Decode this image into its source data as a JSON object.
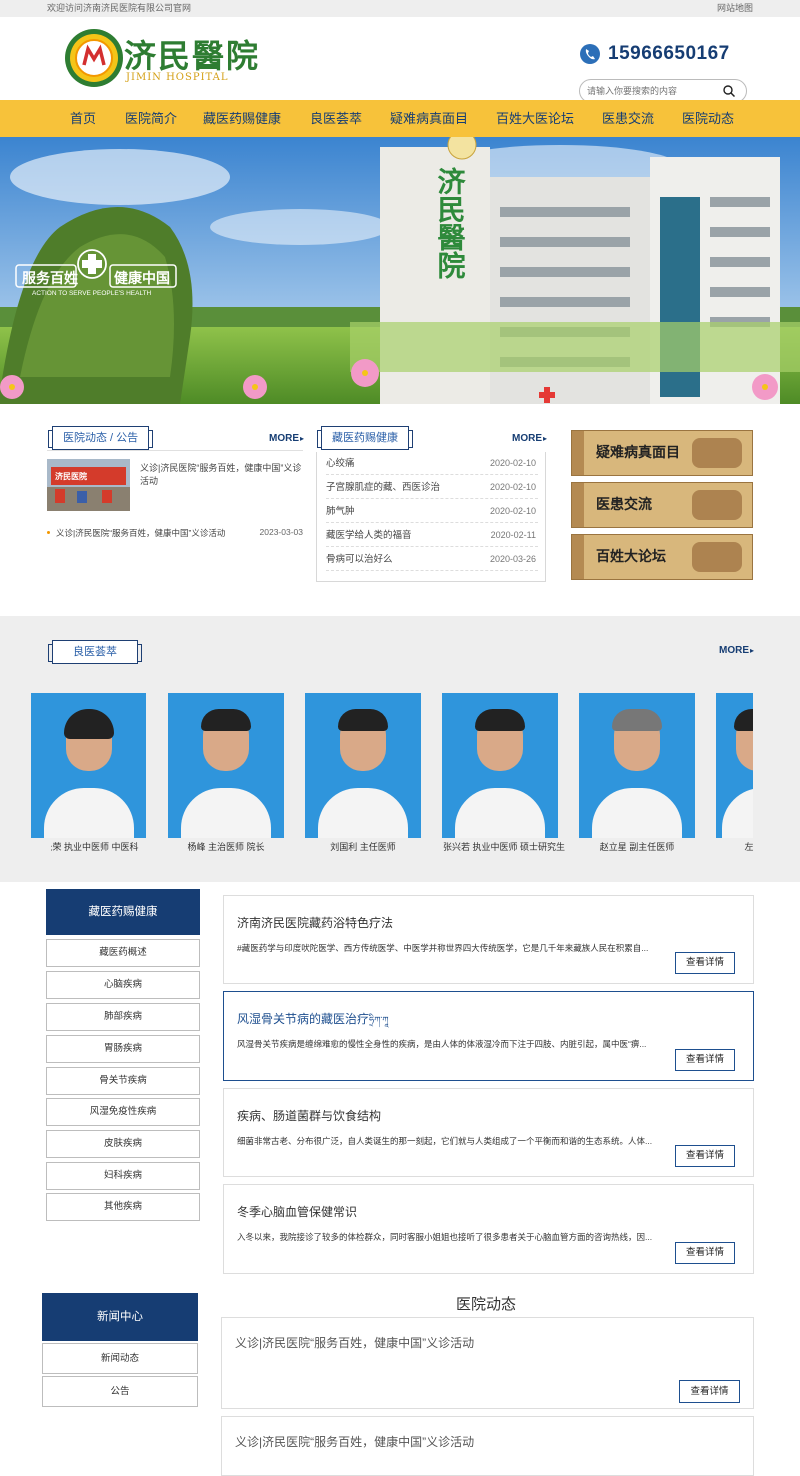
{
  "topbar": {
    "welcome": "欢迎访问济南济民医院有限公司官网",
    "sitemap": "网站地图"
  },
  "header": {
    "logo_cn": "济民醫院",
    "logo_en": "JIMIN HOSPITAL",
    "phone": "15966650167",
    "search_placeholder": "请输入你要搜索的内容"
  },
  "nav": [
    "首页",
    "医院简介",
    "藏医药赐健康",
    "良医荟萃",
    "疑难病真面目",
    "百姓大医论坛",
    "医患交流",
    "医院动态"
  ],
  "banner": {
    "slogan_left": "服务百姓",
    "slogan_right": "健康中国",
    "slogan_en": "ACTION TO SERVE PEOPLE'S HEALTH",
    "building_sign": "济民醫院"
  },
  "news_box": {
    "tab1": "医院动态",
    "tab2": "公告",
    "more": "MORE",
    "image_caption": "济民医院",
    "featured_title": "义诊|济民医院“服务百姓，健康中国”义诊活动",
    "item_title": "义诊|济民医院“服务百姓，健康中国”义诊活动",
    "item_date": "2023-03-03"
  },
  "zang_box": {
    "title": "藏医药赐健康",
    "more": "MORE",
    "items": [
      {
        "title": "心绞痛",
        "date": "2020-02-10"
      },
      {
        "title": "子宫腺肌症的藏、西医诊治",
        "date": "2020-02-10"
      },
      {
        "title": "肺气肿",
        "date": "2020-02-10"
      },
      {
        "title": "藏医学给人类的福音",
        "date": "2020-02-11"
      },
      {
        "title": "骨病可以治好么",
        "date": "2020-03-26"
      }
    ]
  },
  "promo": [
    "疑难病真面目",
    "医患交流",
    "百姓大论坛"
  ],
  "doctors_section": {
    "title": "良医荟萃",
    "more": "MORE",
    "doctors": [
      {
        "caption": "长荣 执业中医师 中医科"
      },
      {
        "caption": "杨峰 主治医师 院长"
      },
      {
        "caption": "刘国利 主任医师"
      },
      {
        "caption": "张兴若 执业中医师 硕士研究生"
      },
      {
        "caption": "赵立星 副主任医师"
      },
      {
        "caption": "左"
      }
    ]
  },
  "category_sidebar": {
    "title": "藏医药赐健康",
    "items": [
      "藏医药概述",
      "心脑疾病",
      "肺部疾病",
      "胃肠疾病",
      "骨关节疾病",
      "风湿免疫性疾病",
      "皮肤疾病",
      "妇科疾病",
      "其他疾病"
    ]
  },
  "articles": [
    {
      "title": "济南济民医院藏药浴特色疗法",
      "desc": "#藏医药学与印度吠陀医学、西方传统医学、中医学并称世界四大传统医学，它是几千年来藏族人民在积累自...",
      "button": "查看详情"
    },
    {
      "title": "风湿骨关节病的藏医治疗",
      "title_extra": "ཧྲིཀ་ཀཱ",
      "desc": "风湿骨关节疾病是缠绵难愈的慢性全身性的疾病，是由人体的体液湿冷而下注于四肢、内脏引起，属中医“痹...",
      "button": "查看详情"
    },
    {
      "title": "疾病、肠道菌群与饮食结构",
      "desc": "细菌非常古老、分布很广泛，自人类诞生的那一刻起，它们就与人类组成了一个平衡而和谐的生态系统。人体...",
      "button": "查看详情"
    },
    {
      "title": "冬季心脑血管保健常识",
      "desc": "入冬以来，我院接诊了较多的体检群众，同时客服小姐姐也接听了很多患者关于心脑血管方面的咨询热线，因...",
      "button": "查看详情"
    }
  ],
  "news_sidebar": {
    "title": "新闻中心",
    "items": [
      "新闻动态",
      "公告"
    ]
  },
  "hospital_news": {
    "heading": "医院动态",
    "items": [
      {
        "title": "义诊|济民医院“服务百姓，健康中国”义诊活动",
        "button": "查看详情"
      },
      {
        "title": "义诊|济民医院“服务百姓，健康中国”义诊活动"
      }
    ]
  },
  "colors": {
    "nav_bg": "#f7c23a",
    "brand_navy": "#163d73",
    "accent_orange": "#f39800",
    "section_gray": "#eeeeee"
  }
}
